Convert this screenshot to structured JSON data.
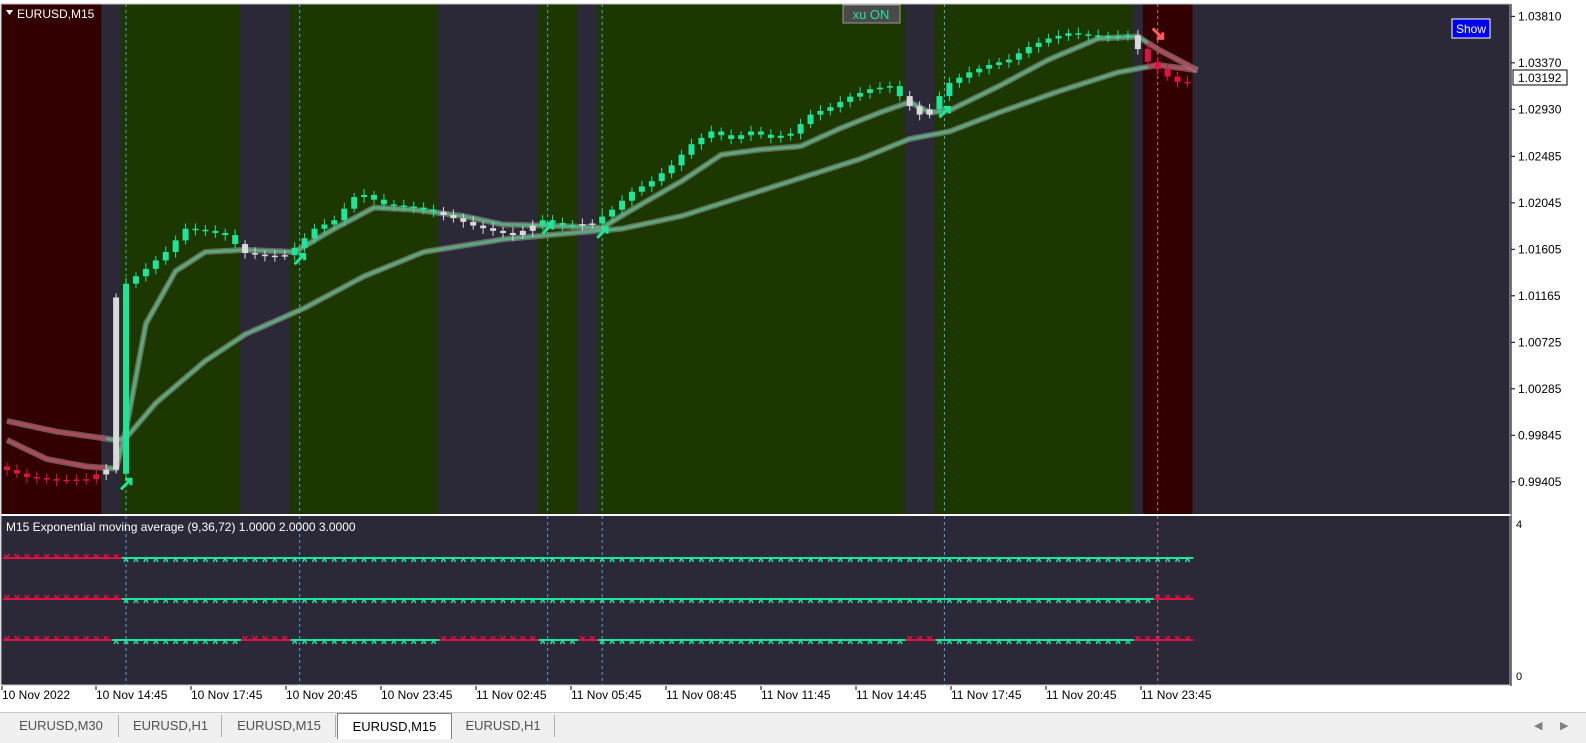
{
  "window": {
    "symbol_label": "EURUSD,M15",
    "xu_button": "xu ON",
    "show_button": "Show",
    "indicator_label": "M15 Exponential moving average (9,36,72) 1.0000 2.0000 3.0000",
    "sub_scale_top": "4",
    "sub_scale_bottom": "0"
  },
  "colors": {
    "background": "#2b2837",
    "bull_zone": "#1d3700",
    "bear_zone": "#330000",
    "neutral_zone": "#2b2837",
    "bull_candle": "#1ee59b",
    "bear_candle": "#dd1245",
    "neutral_candle": "#d9d9d9",
    "fast_ema": "#5aa87c",
    "fast_ema_bear": "#b04a5a",
    "separator": "#4aa8d8"
  },
  "tabs": [
    "EURUSD,M30",
    "EURUSD,H1",
    "EURUSD,M15",
    "EURUSD,M15",
    "EURUSD,H1"
  ],
  "active_tab": 3,
  "chart_data": {
    "type": "candlestick",
    "symbol": "EURUSD",
    "timeframe": "M15",
    "current_price": "1.03192",
    "y_ticks": [
      "1.03810",
      "1.03370",
      "1.02930",
      "1.02485",
      "1.02045",
      "1.01605",
      "1.01165",
      "1.00725",
      "1.00285",
      "0.99845",
      "0.99405"
    ],
    "ylim": [
      0.9928,
      1.0387
    ],
    "x_ticks": [
      "10 Nov 2022",
      "10 Nov 14:45",
      "10 Nov 17:45",
      "10 Nov 20:45",
      "10 Nov 23:45",
      "11 Nov 02:45",
      "11 Nov 05:45",
      "11 Nov 08:45",
      "11 Nov 11:45",
      "11 Nov 14:45",
      "11 Nov 17:45",
      "11 Nov 20:45",
      "11 Nov 23:45"
    ],
    "trend_zones": [
      {
        "state": "bear",
        "from_bar": 0,
        "to_bar": 10
      },
      {
        "state": "neutral",
        "from_bar": 10,
        "to_bar": 12
      },
      {
        "state": "bull",
        "from_bar": 12,
        "to_bar": 24
      },
      {
        "state": "neutral",
        "from_bar": 24,
        "to_bar": 29
      },
      {
        "state": "bull",
        "from_bar": 29,
        "to_bar": 44
      },
      {
        "state": "neutral",
        "from_bar": 44,
        "to_bar": 54
      },
      {
        "state": "bull",
        "from_bar": 54,
        "to_bar": 58
      },
      {
        "state": "neutral",
        "from_bar": 58,
        "to_bar": 60
      },
      {
        "state": "bull",
        "from_bar": 60,
        "to_bar": 91
      },
      {
        "state": "neutral",
        "from_bar": 91,
        "to_bar": 94
      },
      {
        "state": "bull",
        "from_bar": 94,
        "to_bar": 114
      },
      {
        "state": "neutral",
        "from_bar": 114,
        "to_bar": 115
      },
      {
        "state": "bear",
        "from_bar": 115,
        "to_bar": 120
      }
    ],
    "separator_bars": [
      12,
      29.5,
      54.5,
      60,
      94.5,
      116
    ],
    "signals": [
      {
        "bar": 12,
        "direction": "up",
        "price": 0.9941
      },
      {
        "bar": 29.5,
        "direction": "up",
        "price": 1.0154
      },
      {
        "bar": 54.5,
        "direction": "up",
        "price": 1.0183
      },
      {
        "bar": 60,
        "direction": "up",
        "price": 1.0179
      },
      {
        "bar": 94.5,
        "direction": "up",
        "price": 1.0293
      },
      {
        "bar": 116,
        "direction": "down",
        "price": 1.0362
      }
    ],
    "ohlc_anchors": [
      [
        0,
        0.9955
      ],
      [
        3,
        0.9945
      ],
      [
        6,
        0.9942
      ],
      [
        9,
        0.9943
      ],
      [
        11,
        0.9952
      ],
      [
        12,
        1.0115
      ],
      [
        13,
        1.0128
      ],
      [
        15,
        1.0142
      ],
      [
        17,
        1.0158
      ],
      [
        19,
        1.018
      ],
      [
        21,
        1.0178
      ],
      [
        23,
        1.0174
      ],
      [
        25,
        1.0157
      ],
      [
        27,
        1.0154
      ],
      [
        29,
        1.0155
      ],
      [
        30,
        1.0162
      ],
      [
        32,
        1.018
      ],
      [
        34,
        1.0188
      ],
      [
        36,
        1.021
      ],
      [
        37,
        1.0212
      ],
      [
        39,
        1.0203
      ],
      [
        42,
        1.02
      ],
      [
        44,
        1.0196
      ],
      [
        46,
        1.019
      ],
      [
        48,
        1.0183
      ],
      [
        50,
        1.0178
      ],
      [
        52,
        1.0174
      ],
      [
        53,
        1.0178
      ],
      [
        55,
        1.0188
      ],
      [
        57,
        1.0183
      ],
      [
        60,
        1.0185
      ],
      [
        62,
        1.0198
      ],
      [
        64,
        1.0215
      ],
      [
        66,
        1.0225
      ],
      [
        68,
        1.024
      ],
      [
        70,
        1.026
      ],
      [
        72,
        1.0272
      ],
      [
        74,
        1.0265
      ],
      [
        76,
        1.0272
      ],
      [
        78,
        1.0266
      ],
      [
        80,
        1.027
      ],
      [
        82,
        1.0288
      ],
      [
        84,
        1.0295
      ],
      [
        86,
        1.0305
      ],
      [
        88,
        1.0312
      ],
      [
        90,
        1.0315
      ],
      [
        92,
        1.0296
      ],
      [
        93,
        1.0288
      ],
      [
        94,
        1.0293
      ],
      [
        96,
        1.0318
      ],
      [
        98,
        1.0328
      ],
      [
        100,
        1.0335
      ],
      [
        102,
        1.034
      ],
      [
        104,
        1.0352
      ],
      [
        106,
        1.036
      ],
      [
        108,
        1.0365
      ],
      [
        110,
        1.0363
      ],
      [
        112,
        1.0362
      ],
      [
        114,
        1.0363
      ],
      [
        115,
        1.035
      ],
      [
        116,
        1.0338
      ],
      [
        118,
        1.0324
      ],
      [
        119,
        1.0319
      ]
    ],
    "ema_fast_anchors": [
      [
        0,
        0.998
      ],
      [
        4,
        0.9962
      ],
      [
        8,
        0.9955
      ],
      [
        11,
        0.9953
      ],
      [
        12,
        0.999
      ],
      [
        14,
        1.009
      ],
      [
        17,
        1.014
      ],
      [
        20,
        1.0158
      ],
      [
        24,
        1.016
      ],
      [
        29,
        1.0158
      ],
      [
        33,
        1.018
      ],
      [
        37,
        1.02
      ],
      [
        41,
        1.0198
      ],
      [
        46,
        1.0192
      ],
      [
        50,
        1.0184
      ],
      [
        54,
        1.0183
      ],
      [
        60,
        1.0181
      ],
      [
        63,
        1.0198
      ],
      [
        68,
        1.0225
      ],
      [
        72,
        1.025
      ],
      [
        76,
        1.0255
      ],
      [
        80,
        1.0258
      ],
      [
        84,
        1.0275
      ],
      [
        88,
        1.029
      ],
      [
        91,
        1.03
      ],
      [
        93,
        1.029
      ],
      [
        95,
        1.0292
      ],
      [
        100,
        1.0315
      ],
      [
        105,
        1.034
      ],
      [
        110,
        1.036
      ],
      [
        114,
        1.0362
      ],
      [
        116,
        1.035
      ],
      [
        120,
        1.033
      ]
    ],
    "ema_slow_anchors": [
      [
        0,
        0.9998
      ],
      [
        5,
        0.9988
      ],
      [
        11,
        0.998
      ],
      [
        12,
        0.9982
      ],
      [
        15,
        1.0015
      ],
      [
        20,
        1.0055
      ],
      [
        24,
        1.008
      ],
      [
        30,
        1.0105
      ],
      [
        36,
        1.0135
      ],
      [
        42,
        1.0158
      ],
      [
        50,
        1.017
      ],
      [
        57,
        1.0176
      ],
      [
        62,
        1.018
      ],
      [
        68,
        1.0192
      ],
      [
        74,
        1.021
      ],
      [
        80,
        1.0228
      ],
      [
        86,
        1.0246
      ],
      [
        91,
        1.0265
      ],
      [
        95,
        1.0272
      ],
      [
        100,
        1.029
      ],
      [
        106,
        1.031
      ],
      [
        112,
        1.0328
      ],
      [
        116,
        1.0335
      ],
      [
        120,
        1.033
      ]
    ],
    "signal_rows": [
      {
        "flip_segments": [
          {
            "from": 0,
            "to": 12,
            "state": "down"
          },
          {
            "from": 12,
            "to": 120,
            "state": "up"
          }
        ]
      },
      {
        "flip_segments": [
          {
            "from": 0,
            "to": 12,
            "state": "down"
          },
          {
            "from": 12,
            "to": 116,
            "state": "up"
          },
          {
            "from": 116,
            "to": 120,
            "state": "down"
          }
        ]
      },
      {
        "flip_segments": [
          {
            "from": 0,
            "to": 11,
            "state": "down"
          },
          {
            "from": 11,
            "to": 24,
            "state": "up"
          },
          {
            "from": 24,
            "to": 29,
            "state": "down"
          },
          {
            "from": 29,
            "to": 44,
            "state": "up"
          },
          {
            "from": 44,
            "to": 54,
            "state": "down"
          },
          {
            "from": 54,
            "to": 58,
            "state": "up"
          },
          {
            "from": 58,
            "to": 60,
            "state": "down"
          },
          {
            "from": 60,
            "to": 91,
            "state": "up"
          },
          {
            "from": 91,
            "to": 94,
            "state": "down"
          },
          {
            "from": 94,
            "to": 114,
            "state": "up"
          },
          {
            "from": 114,
            "to": 120,
            "state": "down"
          }
        ]
      }
    ],
    "total_bars": 120
  }
}
